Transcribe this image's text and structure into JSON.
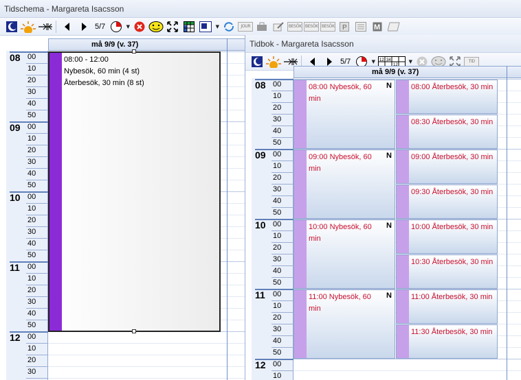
{
  "back_window": {
    "title": "Tidschema - Margareta Isacsson",
    "toolbar": {
      "week_fraction": "5/7"
    },
    "day_header": "må 9/9 (v. 37)",
    "hours": [
      "08",
      "09",
      "10",
      "11",
      "12"
    ],
    "minutes": [
      "00",
      "10",
      "20",
      "30",
      "40",
      "50"
    ],
    "block": {
      "time": "08:00 - 12:00",
      "line1": "Nybesök, 60 min (4 st)",
      "line2": "Återbesök, 30 min (8 st)",
      "bar_color": "#8b2bd8"
    }
  },
  "front_window": {
    "title": "Tidbok - Margareta Isacsson",
    "toolbar": {
      "week_fraction": "5/7"
    },
    "day_header": "må 9/9 (v. 37)",
    "hours": [
      "08",
      "09",
      "10",
      "11",
      "12"
    ],
    "minutes": [
      "00",
      "10",
      "20",
      "30",
      "40",
      "50"
    ],
    "appointments_left": [
      {
        "label": "08:00 Nybesök, 60 min",
        "flag": "N"
      },
      {
        "label": "09:00 Nybesök, 60 min",
        "flag": "N"
      },
      {
        "label": "10:00 Nybesök, 60 min",
        "flag": "N"
      },
      {
        "label": "11:00 Nybesök, 60 min",
        "flag": "N"
      }
    ],
    "appointments_right": [
      {
        "label": "08:00 Återbesök, 30 min"
      },
      {
        "label": "08:30 Återbesök, 30 min"
      },
      {
        "label": "09:00 Återbesök, 30 min"
      },
      {
        "label": "09:30 Återbesök, 30 min"
      },
      {
        "label": "10:00 Återbesök, 30 min"
      },
      {
        "label": "10:30 Återbesök, 30 min"
      },
      {
        "label": "11:00 Återbesök, 30 min"
      },
      {
        "label": "11:30 Återbesök, 30 min"
      }
    ],
    "appt_bar_color": "#c7a0ea",
    "appt_text_color": "#c8102e"
  },
  "toolbar_icons": [
    "calendar-moon-icon",
    "sun-icon",
    "fit-width-icon",
    "prev-icon",
    "next-icon",
    "clock-icon",
    "cancel-icon",
    "smiley-icon",
    "expand-icon",
    "grid-icon",
    "report-icon",
    "refresh-icon",
    "journal-icon",
    "bag-icon",
    "edit-icon",
    "besok-icon",
    "besok-icon",
    "besok-icon",
    "p-icon",
    "list-icon",
    "m-icon",
    "note-icon"
  ]
}
